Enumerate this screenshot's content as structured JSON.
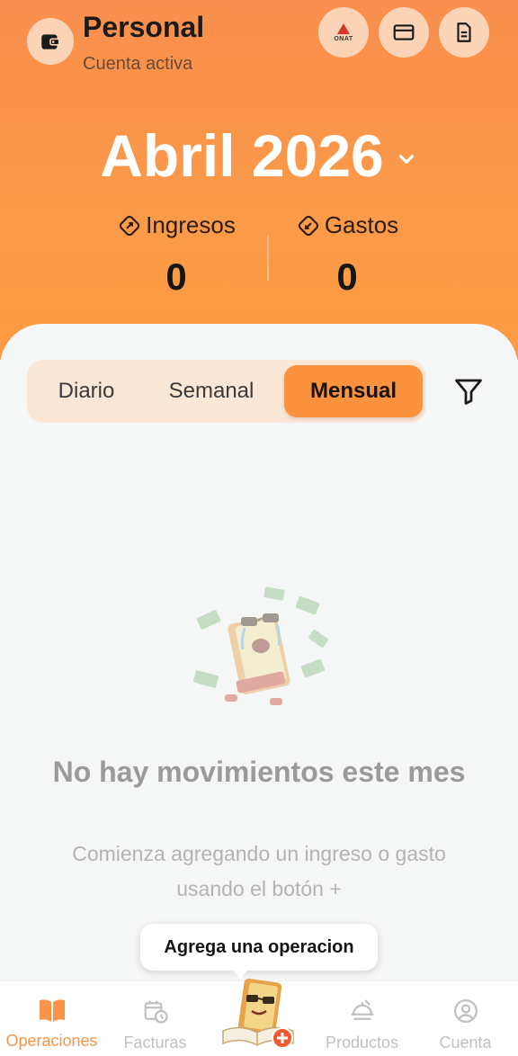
{
  "header": {
    "account_title": "Personal",
    "account_subtitle": "Cuenta activa",
    "onat_label": "ONAT",
    "month": "Abril 2026",
    "income_label": "Ingresos",
    "income_value": "0",
    "expense_label": "Gastos",
    "expense_value": "0"
  },
  "tabs": {
    "items": [
      {
        "label": "Diario",
        "active": false
      },
      {
        "label": "Semanal",
        "active": false
      },
      {
        "label": "Mensual",
        "active": true
      }
    ]
  },
  "empty_state": {
    "title": "No hay movimientos este mes",
    "subtitle": "Comienza agregando un ingreso o gasto usando el botón +"
  },
  "tooltip": {
    "text": "Agrega una operacion"
  },
  "nav": {
    "items": [
      {
        "label": "Operaciones",
        "icon": "book-icon",
        "active": true
      },
      {
        "label": "Facturas",
        "icon": "calendar-clock-icon",
        "active": false
      },
      {
        "label": "Productos",
        "icon": "food-tray-icon",
        "active": false
      },
      {
        "label": "Cuenta",
        "icon": "user-circle-icon",
        "active": false
      }
    ]
  },
  "colors": {
    "accent": "#fa923e",
    "header_top": "#f98f4e",
    "header_bottom": "#fc9b43",
    "segment_bg": "#fbe7d6"
  }
}
